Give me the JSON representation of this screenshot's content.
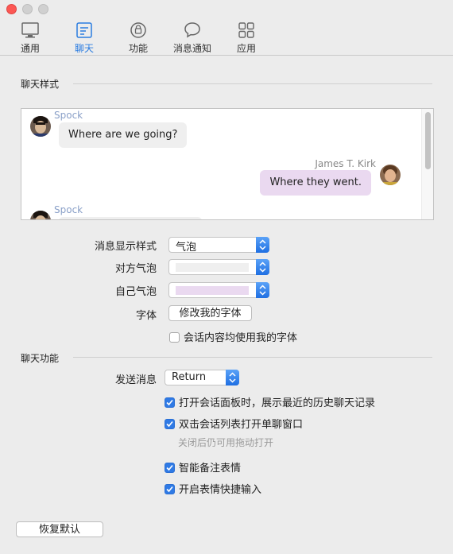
{
  "window": {
    "toolbar": {
      "tabs": [
        {
          "label": "通用",
          "icon": "monitor-icon"
        },
        {
          "label": "聊天",
          "icon": "chat-settings-icon",
          "active": true
        },
        {
          "label": "功能",
          "icon": "feature-icon"
        },
        {
          "label": "消息通知",
          "icon": "speech-bubble-icon"
        },
        {
          "label": "应用",
          "icon": "app-grid-icon"
        }
      ]
    }
  },
  "chat_style": {
    "title": "聊天样式",
    "preview": {
      "messages": [
        {
          "sender": "Spock",
          "text": "Where are we going?",
          "side": "left"
        },
        {
          "sender": "James T. Kirk",
          "text": "Where they went.",
          "side": "right"
        },
        {
          "sender": "Spock",
          "text": "",
          "side": "left"
        }
      ]
    },
    "display_style_label": "消息显示样式",
    "display_style_value": "气泡",
    "other_bubble_label": "对方气泡",
    "other_bubble_color": "#efefef",
    "self_bubble_label": "自己气泡",
    "self_bubble_color": "#ead9f0",
    "font_label": "字体",
    "font_button": "修改我的字体",
    "use_my_font_label": "会话内容均使用我的字体",
    "use_my_font_checked": false
  },
  "chat_features": {
    "title": "聊天功能",
    "send_label": "发送消息",
    "send_value": "Return",
    "options": [
      {
        "label": "打开会话面板时，展示最近的历史聊天记录",
        "checked": true
      },
      {
        "label": "双击会话列表打开单聊窗口",
        "checked": true
      },
      {
        "label": "智能备注表情",
        "checked": true
      },
      {
        "label": "开启表情快捷输入",
        "checked": true
      }
    ],
    "double_click_hint": "关闭后仍可用拖动打开"
  },
  "restore_button": "恢复默认",
  "colors": {
    "accent": "#2a7ce0",
    "checkbox": "#2f7ae5"
  }
}
